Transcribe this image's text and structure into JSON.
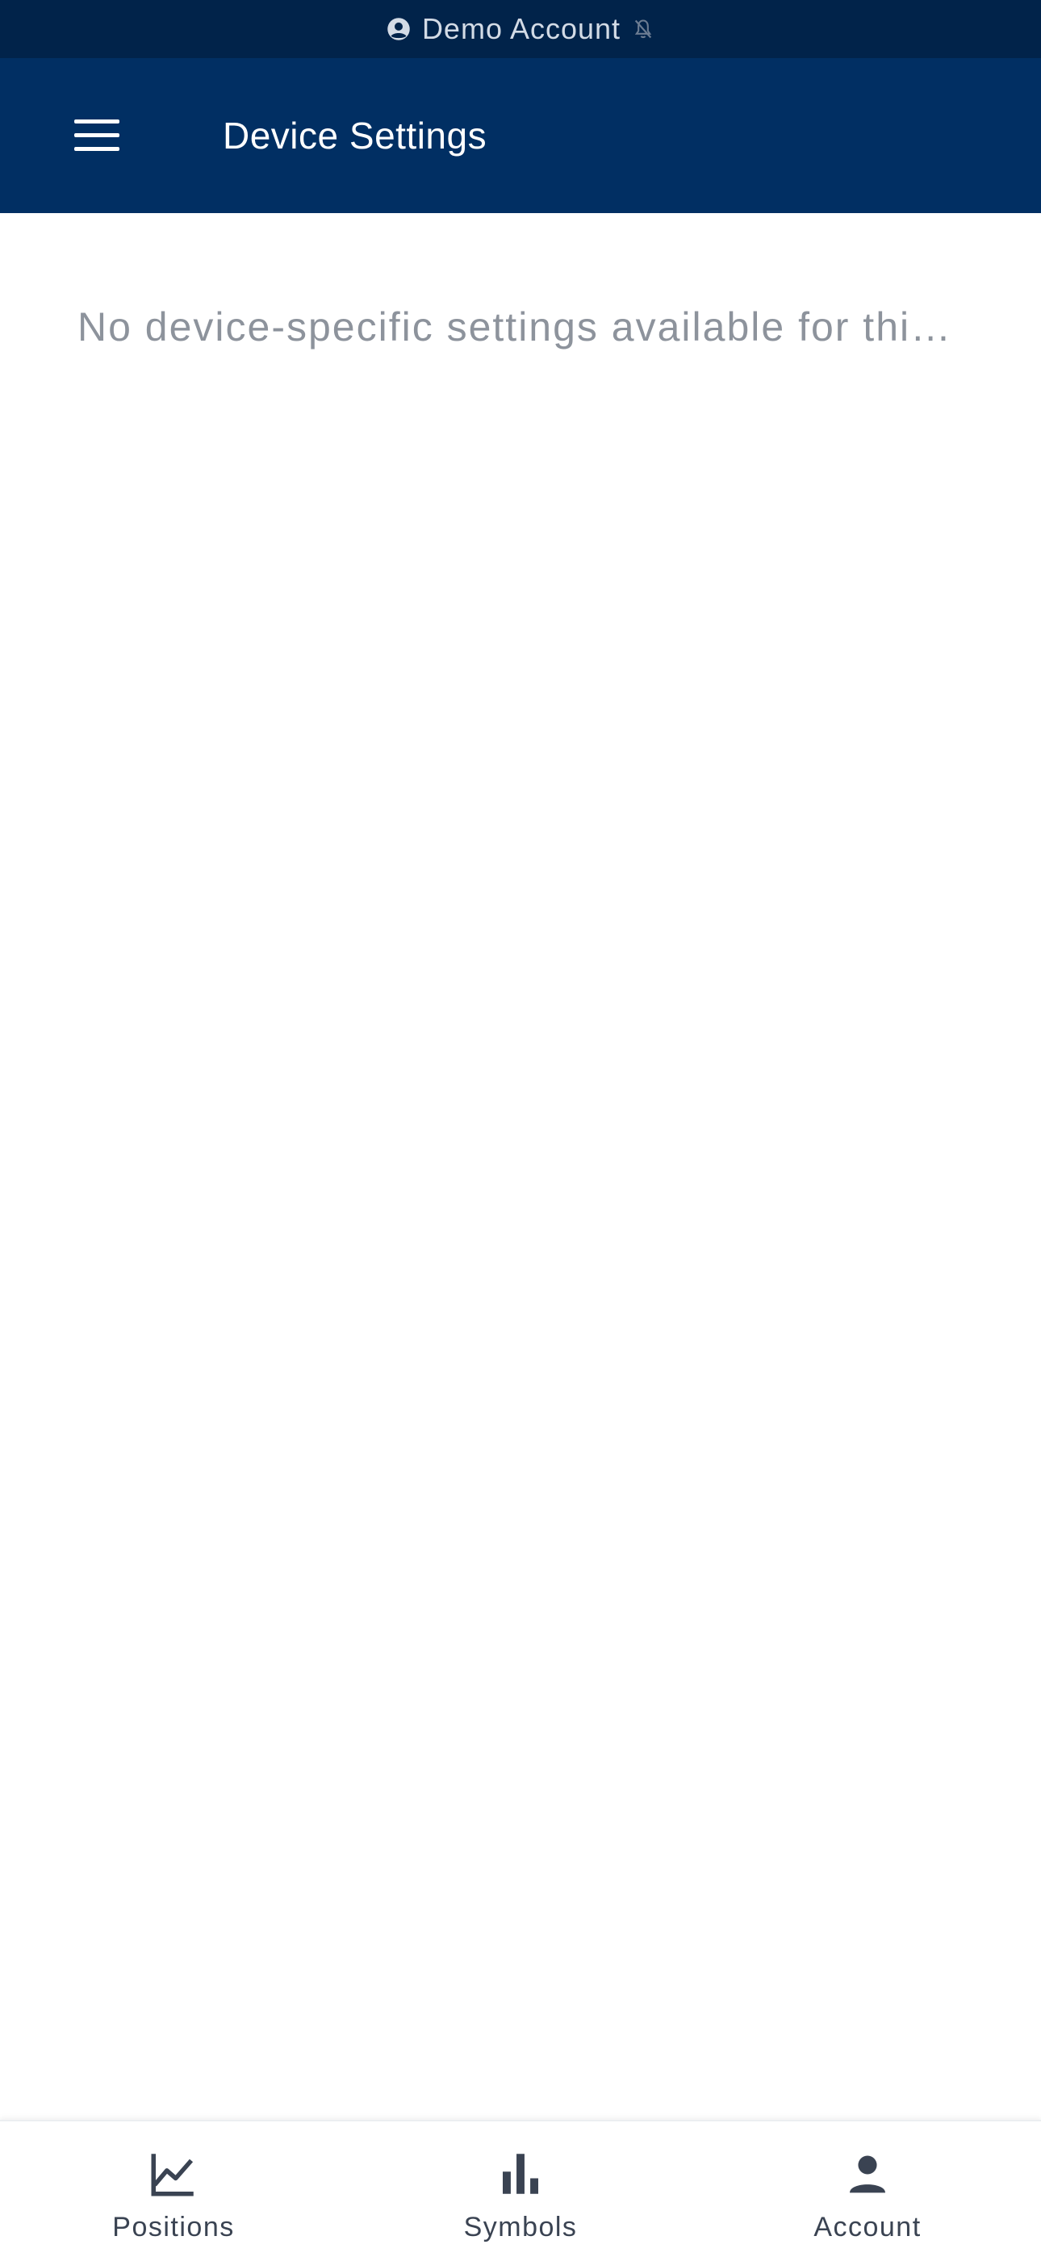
{
  "banner": {
    "account_label": "Demo Account",
    "icons": [
      "user-circle-icon",
      "mute-bell-icon"
    ]
  },
  "header": {
    "title": "Device Settings",
    "menu_icon": "hamburger-menu-icon"
  },
  "main": {
    "empty_message": "No device-specific settings available for thi…"
  },
  "bottom_nav": {
    "items": [
      {
        "label": "Positions",
        "icon": "line-chart-icon"
      },
      {
        "label": "Symbols",
        "icon": "bar-chart-icon"
      },
      {
        "label": "Account",
        "icon": "person-icon"
      }
    ]
  },
  "colors": {
    "banner_bg": "#01234a",
    "header_bg": "#012f63",
    "message_text": "#8d939c",
    "nav_text": "#3a4352"
  }
}
